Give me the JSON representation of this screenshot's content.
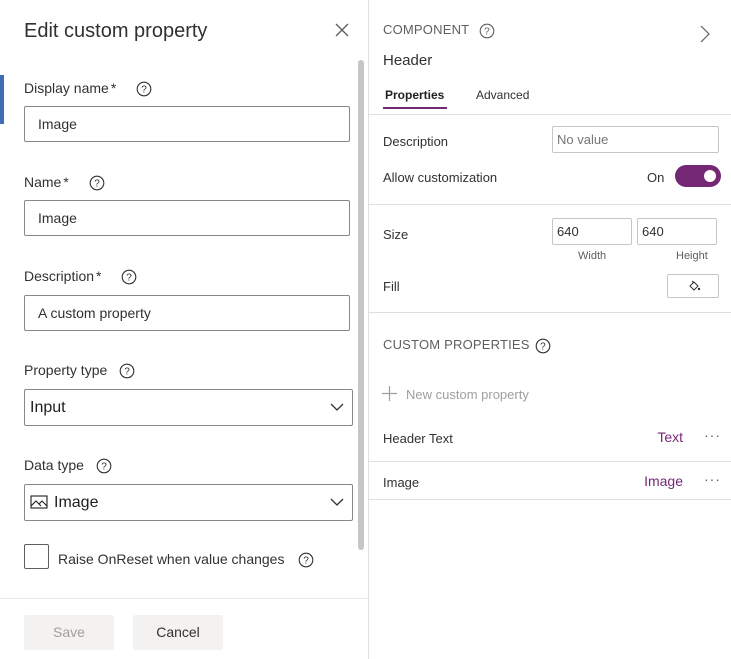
{
  "edit_panel": {
    "title": "Edit custom property",
    "display_name": {
      "label": "Display name",
      "required_mark": "*",
      "value": "Image"
    },
    "name": {
      "label": "Name",
      "required_mark": "*",
      "value": "Image"
    },
    "description": {
      "label": "Description",
      "required_mark": "*",
      "value": "A custom property"
    },
    "property_type": {
      "label": "Property type",
      "selected": "Input"
    },
    "data_type": {
      "label": "Data type",
      "selected": "Image"
    },
    "raise_on_reset": {
      "label": "Raise OnReset when value changes",
      "checked": false
    },
    "save_label": "Save",
    "cancel_label": "Cancel"
  },
  "properties_pane": {
    "section_label": "COMPONENT",
    "component_name": "Header",
    "tabs": [
      {
        "label": "Properties",
        "active": true
      },
      {
        "label": "Advanced",
        "active": false
      }
    ],
    "description": {
      "label": "Description",
      "placeholder": "No value"
    },
    "allow_customization": {
      "label": "Allow customization",
      "state_text": "On",
      "on": true
    },
    "size": {
      "label": "Size",
      "width": "640",
      "height": "640",
      "width_caption": "Width",
      "height_caption": "Height"
    },
    "fill": {
      "label": "Fill"
    },
    "custom_properties": {
      "title": "CUSTOM PROPERTIES",
      "new_label": "New custom property",
      "items": [
        {
          "name": "Header Text",
          "type": "Text",
          "more": "···"
        },
        {
          "name": "Image",
          "type": "Image",
          "more": "···"
        }
      ]
    }
  },
  "colors": {
    "accent": "#742774",
    "selection_strip": "#3e6fb6"
  }
}
